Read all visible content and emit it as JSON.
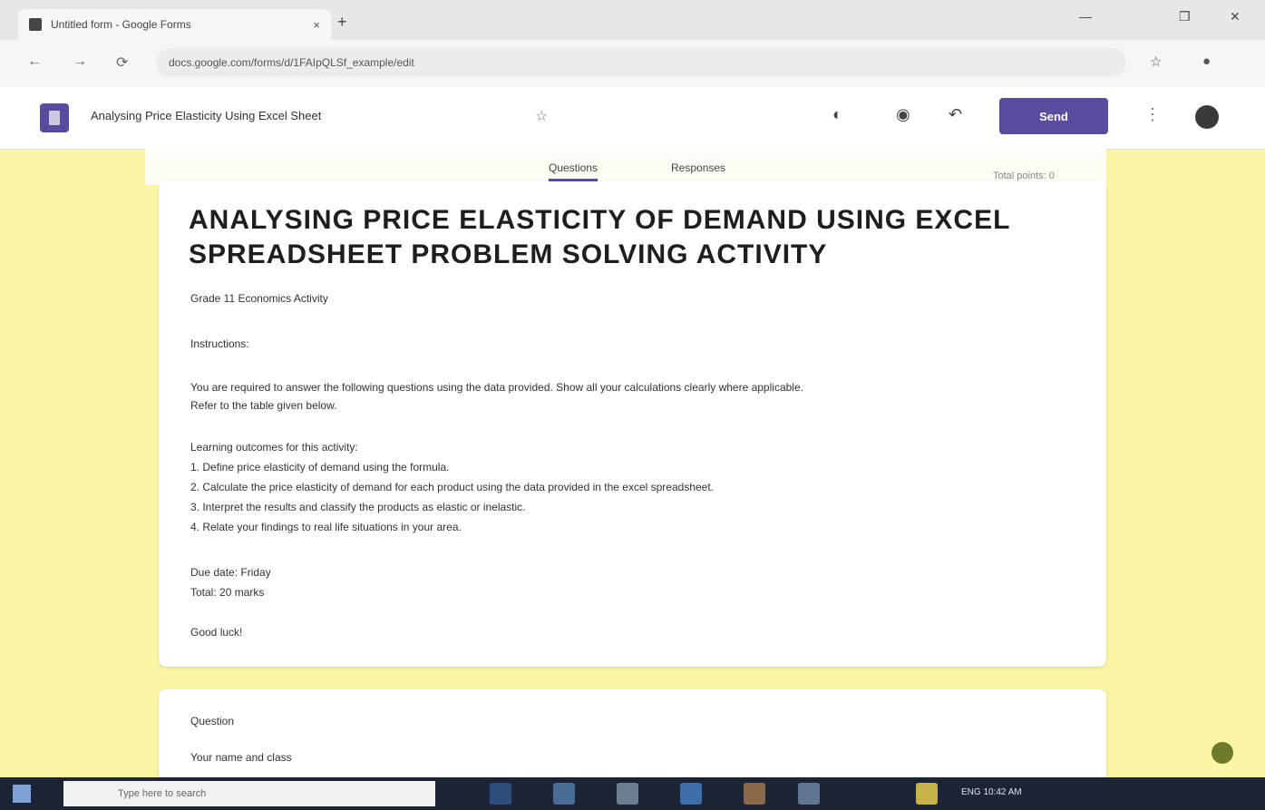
{
  "browser": {
    "tab_title": "Untitled form - Google Forms",
    "tab_close": "×",
    "new_tab": "+",
    "win_min": "—",
    "win_max": "❐",
    "win_close": "✕",
    "back": "←",
    "forward": "→",
    "reload": "⟳",
    "url": "docs.google.com/forms/d/1FAIpQLSf_example/edit",
    "bookmark": "☆",
    "profile": "●"
  },
  "forms_app": {
    "form_name": "Analysing Price Elasticity Using Excel Sheet",
    "star": "☆",
    "palette_icon": "◐",
    "preview_icon": "◉",
    "undo_icon": "↶",
    "send_label": "Send",
    "more_icon": "⋮"
  },
  "canvas": {
    "tab_questions": "Questions",
    "tab_responses": "Responses",
    "total_points": "Total points: 0",
    "title": "ANALYSING PRICE ELASTICITY OF DEMAND USING EXCEL SPREADSHEET PROBLEM SOLVING ACTIVITY",
    "description": [
      "Grade 11 Economics Activity",
      "Instructions:",
      "You are required to answer the following questions using the data provided. Show all your calculations clearly where applicable.",
      "Refer to the table given below.",
      "Learning outcomes for this activity:",
      "1. Define price elasticity of demand using the formula.",
      "2. Calculate the price elasticity of demand for each product using the data provided in the excel spreadsheet.",
      "3. Interpret the results and classify the products as elastic or inelastic.",
      "4. Relate your findings to real life situations in your area.",
      "Due date: Friday",
      "Total: 20 marks",
      "Good luck!"
    ],
    "next_card_label": "Question",
    "next_card_text": "Your name and class"
  },
  "taskbar": {
    "search_placeholder": "Type here to search",
    "tray": "ENG  10:42 AM"
  }
}
